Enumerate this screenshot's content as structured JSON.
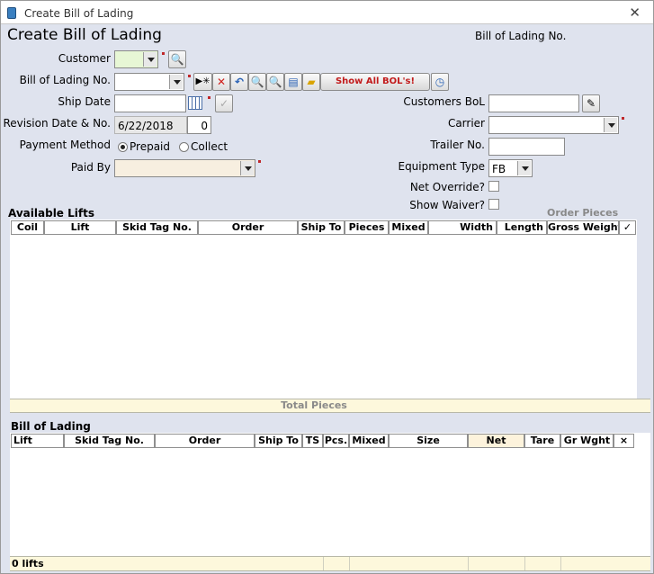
{
  "window": {
    "title": "Create Bill of Lading"
  },
  "header": {
    "title": "Create Bill of Lading",
    "bol_no_label": "Bill of Lading No."
  },
  "form": {
    "customer_label": "Customer",
    "bol_no_label": "Bill of Lading No.",
    "ship_date_label": "Ship Date",
    "revision_label": "Revision Date & No.",
    "revision_date": "6/22/2018",
    "revision_no": "0",
    "payment_method_label": "Payment Method",
    "prepaid_label": "Prepaid",
    "collect_label": "Collect",
    "paid_by_label": "Paid By",
    "customers_bol_label": "Customers BoL",
    "carrier_label": "Carrier",
    "trailer_no_label": "Trailer No.",
    "equipment_type_label": "Equipment Type",
    "equipment_type_value": "FB",
    "net_override_label": "Net Override?",
    "show_waiver_label": "Show Waiver?",
    "show_all_label": "Show All BOL's!"
  },
  "colors": {
    "required": "#c0282a",
    "window_bg": "#dfe3ee",
    "strip": "#fdf8dc",
    "net_header": "#fdf3dc"
  },
  "available": {
    "title": "Available Lifts",
    "order_pieces_label": "Order Pieces",
    "columns": [
      "Coil",
      "Lift",
      "Skid Tag No.",
      "Order",
      "Ship To",
      "Pieces",
      "Mixed",
      "Width",
      "Length",
      "Gross Weight",
      "✓"
    ],
    "total_label": "Total Pieces"
  },
  "bol": {
    "title": "Bill of Lading",
    "columns": [
      "Lift",
      "Skid Tag No.",
      "Order",
      "Ship To",
      "TS",
      "Pcs.",
      "Mixed",
      "Size",
      "Net",
      "Tare",
      "Gr Wght",
      "×"
    ],
    "footer_count": "0 lifts"
  }
}
